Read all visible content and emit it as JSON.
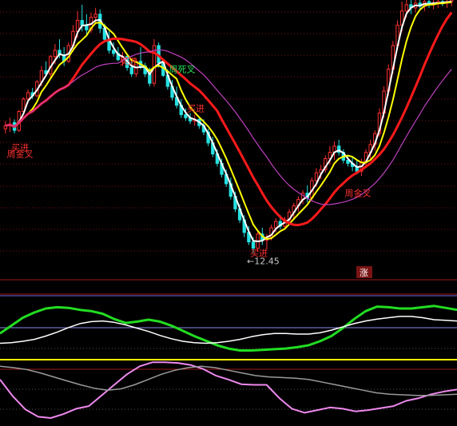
{
  "chart_data": [
    {
      "type": "candlestick",
      "panel": "main",
      "ylim": [
        11.2,
        28.5
      ],
      "grid": true,
      "up_color": "#ff3030",
      "down_color": "#26e0e0",
      "candles": [
        [
          20.3,
          20.8,
          20.0,
          20.5
        ],
        [
          20.5,
          21.0,
          20.1,
          20.6
        ],
        [
          20.7,
          20.9,
          20.0,
          20.2
        ],
        [
          20.2,
          21.5,
          20.1,
          21.4
        ],
        [
          21.4,
          22.3,
          21.2,
          22.2
        ],
        [
          22.2,
          22.8,
          21.9,
          22.6
        ],
        [
          22.6,
          22.9,
          22.2,
          22.4
        ],
        [
          22.4,
          23.4,
          22.3,
          23.3
        ],
        [
          23.3,
          24.3,
          23.0,
          24.0
        ],
        [
          24.0,
          24.6,
          23.6,
          23.8
        ],
        [
          23.8,
          25.0,
          23.5,
          24.9
        ],
        [
          24.9,
          25.7,
          24.4,
          25.3
        ],
        [
          25.3,
          26.0,
          24.8,
          25.0
        ],
        [
          25.0,
          25.5,
          24.3,
          24.6
        ],
        [
          24.6,
          25.8,
          24.5,
          25.6
        ],
        [
          25.6,
          26.9,
          25.2,
          26.5
        ],
        [
          26.5,
          27.8,
          26.1,
          27.2
        ],
        [
          27.2,
          28.2,
          26.5,
          26.9
        ],
        [
          26.9,
          27.6,
          26.2,
          26.6
        ],
        [
          26.6,
          27.7,
          26.4,
          27.4
        ],
        [
          27.4,
          28.0,
          27.0,
          27.6
        ],
        [
          27.6,
          27.9,
          26.4,
          26.7
        ],
        [
          26.7,
          27.0,
          25.9,
          26.0
        ],
        [
          26.0,
          26.5,
          25.1,
          25.3
        ],
        [
          25.3,
          25.8,
          24.9,
          25.1
        ],
        [
          25.1,
          25.5,
          24.6,
          24.7
        ],
        [
          24.7,
          25.2,
          24.3,
          24.9
        ],
        [
          24.9,
          25.0,
          24.0,
          24.2
        ],
        [
          24.2,
          24.6,
          23.6,
          23.8
        ],
        [
          23.8,
          24.8,
          23.6,
          24.6
        ],
        [
          24.6,
          25.5,
          24.1,
          24.3
        ],
        [
          24.3,
          24.5,
          23.6,
          23.8
        ],
        [
          23.8,
          24.2,
          23.0,
          23.2
        ],
        [
          23.2,
          26.0,
          23.0,
          25.6
        ],
        [
          25.6,
          25.8,
          24.2,
          24.5
        ],
        [
          24.5,
          24.7,
          23.6,
          23.7
        ],
        [
          23.7,
          24.1,
          22.8,
          23.0
        ],
        [
          23.0,
          23.4,
          22.1,
          22.3
        ],
        [
          22.3,
          23.0,
          21.6,
          21.8
        ],
        [
          21.8,
          22.2,
          21.0,
          21.2
        ],
        [
          21.2,
          21.6,
          20.8,
          21.0
        ],
        [
          21.0,
          21.3,
          20.6,
          20.8
        ],
        [
          20.8,
          21.2,
          20.5,
          20.9
        ],
        [
          20.9,
          21.0,
          20.3,
          20.5
        ],
        [
          20.5,
          20.9,
          19.9,
          20.1
        ],
        [
          20.1,
          20.3,
          19.2,
          19.4
        ],
        [
          19.4,
          19.8,
          18.5,
          18.7
        ],
        [
          18.7,
          19.0,
          17.9,
          18.1
        ],
        [
          18.1,
          18.4,
          17.2,
          17.4
        ],
        [
          17.4,
          17.7,
          16.6,
          16.8
        ],
        [
          16.8,
          17.2,
          15.8,
          16.0
        ],
        [
          16.0,
          16.3,
          15.0,
          15.2
        ],
        [
          15.2,
          15.5,
          14.3,
          14.5
        ],
        [
          14.5,
          14.8,
          13.4,
          13.7
        ],
        [
          13.7,
          14.1,
          12.9,
          13.1
        ],
        [
          13.1,
          13.4,
          12.4,
          12.7
        ],
        [
          12.7,
          13.8,
          12.45,
          13.6
        ],
        [
          13.6,
          14.0,
          12.9,
          13.2
        ],
        [
          13.2,
          13.6,
          12.6,
          13.4
        ],
        [
          13.4,
          14.2,
          13.2,
          14.0
        ],
        [
          14.0,
          14.6,
          13.7,
          14.4
        ],
        [
          14.4,
          14.8,
          13.9,
          14.1
        ],
        [
          14.1,
          14.7,
          13.9,
          14.5
        ],
        [
          14.5,
          15.2,
          14.2,
          15.0
        ],
        [
          15.0,
          15.6,
          14.6,
          15.4
        ],
        [
          15.4,
          16.0,
          15.0,
          15.8
        ],
        [
          15.8,
          16.4,
          15.5,
          16.2
        ],
        [
          16.2,
          16.7,
          15.6,
          15.9
        ],
        [
          15.9,
          17.2,
          15.7,
          17.0
        ],
        [
          17.0,
          17.8,
          16.6,
          17.5
        ],
        [
          17.5,
          18.0,
          17.1,
          17.7
        ],
        [
          17.7,
          18.6,
          17.5,
          18.4
        ],
        [
          18.4,
          19.2,
          18.0,
          18.8
        ],
        [
          18.8,
          19.5,
          18.3,
          19.2
        ],
        [
          19.2,
          19.6,
          18.6,
          18.8
        ],
        [
          18.8,
          19.0,
          18.1,
          18.3
        ],
        [
          18.3,
          18.6,
          17.9,
          18.1
        ],
        [
          18.1,
          18.5,
          17.6,
          17.9
        ],
        [
          17.9,
          18.3,
          17.4,
          17.6
        ],
        [
          17.6,
          18.4,
          17.3,
          18.2
        ],
        [
          18.2,
          19.0,
          17.9,
          18.8
        ],
        [
          18.8,
          19.6,
          18.4,
          19.3
        ],
        [
          19.3,
          20.2,
          18.9,
          20.0
        ],
        [
          20.0,
          21.6,
          19.8,
          21.3
        ],
        [
          21.3,
          23.0,
          21.0,
          22.7
        ],
        [
          22.7,
          24.4,
          22.4,
          24.1
        ],
        [
          24.1,
          25.9,
          23.8,
          25.6
        ],
        [
          25.6,
          27.2,
          25.3,
          26.9
        ],
        [
          26.9,
          28.4,
          26.5,
          27.8
        ],
        [
          27.8,
          28.5,
          27.4,
          28.2
        ],
        [
          28.2,
          28.5,
          27.6,
          28.0
        ],
        [
          28.0,
          28.5,
          27.7,
          28.3
        ],
        [
          28.3,
          28.5,
          27.9,
          28.1
        ],
        [
          28.1,
          28.5,
          27.8,
          28.4
        ],
        [
          28.4,
          28.5,
          28.0,
          28.2
        ],
        [
          28.2,
          28.5,
          27.9,
          28.3
        ],
        [
          28.3,
          28.5,
          28.0,
          28.4
        ],
        [
          28.4,
          28.5,
          28.1,
          28.3
        ],
        [
          28.3,
          28.5,
          28.0,
          28.4
        ],
        [
          28.4,
          28.5,
          28.1,
          28.5
        ]
      ],
      "annotations": [
        {
          "text": "买进",
          "color": "#ff3030",
          "index": 2,
          "value": 18.9
        },
        {
          "text": "周金叉",
          "color": "#ff3030",
          "index": 1,
          "value": 18.5
        },
        {
          "text": "买进",
          "color": "#ff3030",
          "index": 26,
          "value": 24.4
        },
        {
          "text": "周死叉",
          "color": "#26e05a",
          "index": 37,
          "value": 23.9
        },
        {
          "text": "买进",
          "color": "#ff3030",
          "index": 41,
          "value": 21.4
        },
        {
          "text": "买进",
          "color": "#ff3030",
          "index": 55,
          "value": 12.2
        },
        {
          "text": "周金叉",
          "color": "#ff3030",
          "index": 76,
          "value": 16.0
        }
      ],
      "low_label": "←12.45",
      "badge": "涨"
    },
    {
      "type": "line",
      "panel": "indicator-1",
      "ylim": [
        0,
        100
      ],
      "series": [
        {
          "color": "#22dd22",
          "values": [
            40,
            52,
            64,
            72,
            78,
            80,
            79,
            76,
            74,
            70,
            62,
            56,
            58,
            61,
            58,
            52,
            44,
            36,
            29,
            22,
            17,
            14,
            14,
            15,
            16,
            17,
            19,
            22,
            28,
            36,
            48,
            62,
            74,
            81,
            80,
            78,
            78,
            80,
            82,
            79,
            76
          ]
        },
        {
          "color": "#ffffff",
          "values": [
            25,
            26,
            28,
            31,
            36,
            42,
            49,
            55,
            58,
            59,
            57,
            53,
            48,
            43,
            37,
            32,
            28,
            26,
            25,
            26,
            28,
            31,
            35,
            38,
            40,
            40,
            39,
            39,
            41,
            45,
            50,
            55,
            59,
            62,
            64,
            66,
            66,
            64,
            61,
            60,
            59
          ]
        }
      ]
    },
    {
      "type": "line",
      "panel": "indicator-2",
      "ylim": [
        0,
        100
      ],
      "series": [
        {
          "color": "#ee88ee",
          "values": [
            70,
            45,
            25,
            14,
            12,
            18,
            26,
            30,
            46,
            62,
            78,
            90,
            96,
            96,
            95,
            92,
            86,
            76,
            70,
            63,
            62,
            62,
            42,
            26,
            20,
            24,
            28,
            26,
            22,
            24,
            27,
            30,
            38,
            42,
            48,
            52,
            55
          ]
        },
        {
          "color": "#9a9a9a",
          "values": [
            90,
            88,
            85,
            80,
            74,
            68,
            62,
            57,
            54,
            56,
            62,
            70,
            78,
            84,
            88,
            90,
            88,
            84,
            80,
            76,
            74,
            73,
            72,
            70,
            66,
            62,
            58,
            54,
            50,
            48,
            47,
            46,
            46,
            47,
            48
          ]
        }
      ]
    }
  ]
}
